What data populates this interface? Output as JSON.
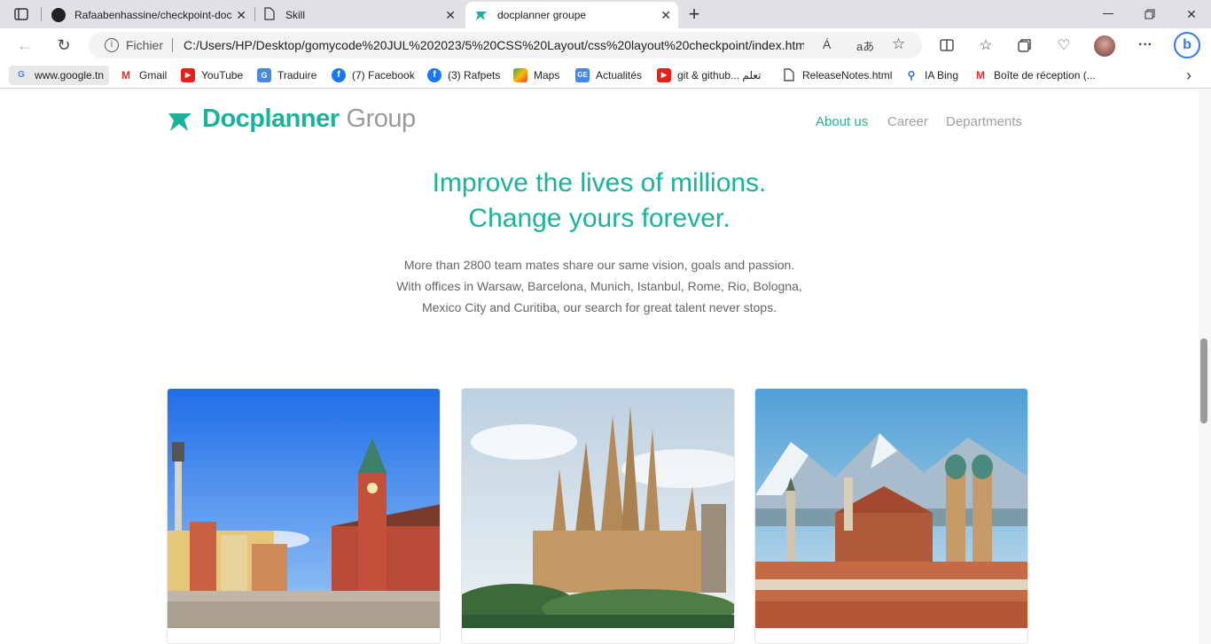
{
  "browser": {
    "tabs": [
      {
        "title": "Rafaabenhassine/checkpoint-doc",
        "active": false
      },
      {
        "title": "Skill",
        "active": false
      },
      {
        "title": "docplanner groupe",
        "active": true
      }
    ],
    "new_tab": "+",
    "address_prefix": "Fichier",
    "url": "C:/Users/HP/Desktop/gomycode%20JUL%202023/5%20CSS%20Layout/css%20layout%20checkpoint/index.html",
    "translate_glyph": "aあ",
    "read_aloud_glyph": "Á",
    "more_glyph": "···",
    "bookmarks": [
      {
        "label": "www.google.tn",
        "icon": "google-icon"
      },
      {
        "label": "Gmail",
        "icon": "gmail-icon"
      },
      {
        "label": "YouTube",
        "icon": "youtube-icon"
      },
      {
        "label": "Traduire",
        "icon": "translate-icon"
      },
      {
        "label": "(7) Facebook",
        "icon": "facebook-icon"
      },
      {
        "label": "(3) Rafpets",
        "icon": "facebook-icon"
      },
      {
        "label": "Maps",
        "icon": "maps-icon"
      },
      {
        "label": "Actualités",
        "icon": "news-icon"
      },
      {
        "label": "git & github... تعلم",
        "icon": "youtube-icon"
      },
      {
        "label": "ReleaseNotes.html",
        "icon": "file-icon"
      },
      {
        "label": "IA Bing",
        "icon": "bing-search-icon"
      },
      {
        "label": "Boîte de réception (...",
        "icon": "gmail-icon"
      }
    ],
    "colors": {
      "accent": "#1ab39a",
      "tabbar": "#dfe1e5"
    }
  },
  "page": {
    "logo": {
      "brand": "Docplanner",
      "suffix": "Group"
    },
    "nav": [
      {
        "label": "About us",
        "active": true
      },
      {
        "label": "Career",
        "active": false
      },
      {
        "label": "Departments",
        "active": false
      }
    ],
    "hero": {
      "line1": "Improve the lives of millions.",
      "line2": "Change yours forever."
    },
    "intro": {
      "line1": "More than 2800 team mates share our same vision, goals and passion.",
      "line2": "With offices in Warsaw, Barcelona, Munich, Istanbul, Rome, Rio, Bologna,",
      "line3": "Mexico City and Curitiba, our search for great talent never stops."
    },
    "cards": [
      {
        "image": "warsaw-castle-square-photo"
      },
      {
        "image": "barcelona-sagrada-familia-photo"
      },
      {
        "image": "munich-frauenkirche-photo"
      }
    ]
  }
}
